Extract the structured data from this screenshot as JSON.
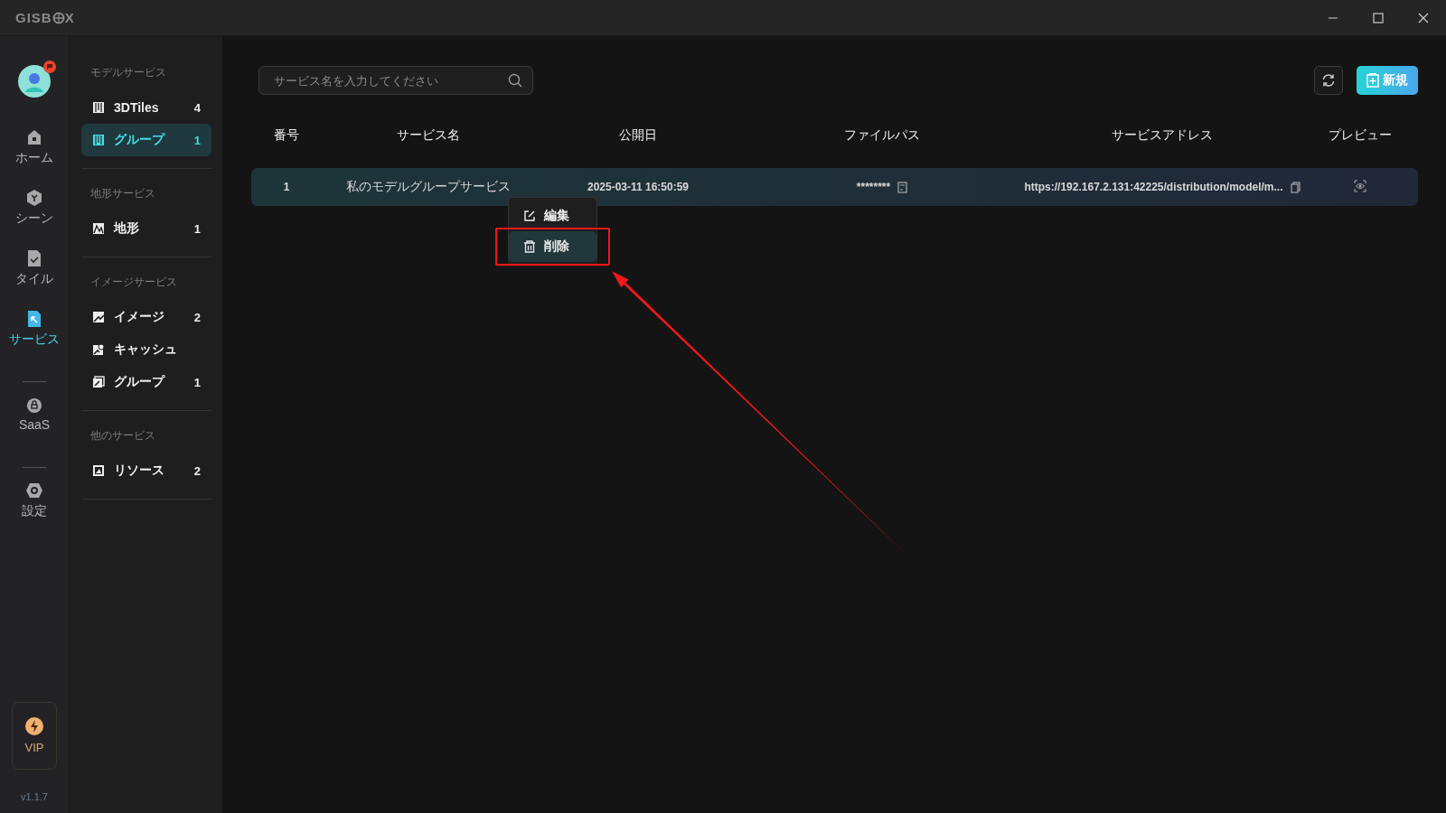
{
  "window": {
    "logo": {
      "before": "GISB",
      "after": "X"
    }
  },
  "rail": {
    "avatar": {
      "badge": true
    },
    "items": [
      {
        "kind": "home",
        "label": "ホーム",
        "selected": false
      },
      {
        "kind": "scene",
        "label": "シーン",
        "selected": false
      },
      {
        "kind": "tile",
        "label": "タイル",
        "selected": false
      },
      {
        "kind": "service",
        "label": "サービス",
        "selected": true
      },
      {
        "kind": "divider"
      },
      {
        "kind": "saas",
        "label": "SaaS",
        "selected": false
      },
      {
        "kind": "divider"
      },
      {
        "kind": "settings",
        "label": "設定",
        "selected": false
      }
    ],
    "vip": {
      "label": "VIP"
    },
    "version": "v1.1.7"
  },
  "sidebar": {
    "sections": [
      {
        "title": "モデルサービス",
        "items": [
          {
            "kind": "model",
            "label": "3DTiles",
            "count": "4",
            "selected": false
          },
          {
            "kind": "model",
            "label": "グループ",
            "count": "1",
            "selected": true
          }
        ]
      },
      {
        "title": "地形サービス",
        "items": [
          {
            "kind": "terrain",
            "label": "地形",
            "count": "1",
            "selected": false
          }
        ]
      },
      {
        "title": "イメージサービス",
        "items": [
          {
            "kind": "image",
            "label": "イメージ",
            "count": "2",
            "selected": false
          },
          {
            "kind": "cache",
            "label": "キャッシュ",
            "selected": false
          },
          {
            "kind": "stack",
            "label": "グループ",
            "count": "1",
            "selected": false
          }
        ]
      },
      {
        "title": "他のサービス",
        "items": [
          {
            "kind": "resource",
            "label": "リソース",
            "count": "2",
            "selected": false
          }
        ]
      }
    ]
  },
  "toolbar": {
    "search": {
      "placeholder": "サービス名を入力してください"
    },
    "new_button": "新規"
  },
  "table": {
    "columns": [
      "番号",
      "サービス名",
      "公開日",
      "ファイルパス",
      "サービスアドレス",
      "プレビュー"
    ],
    "rows": [
      {
        "number": "1",
        "name": "私のモデルグループサービス",
        "date": "2025-03-11 16:50:59",
        "path": "********",
        "address": "https://192.167.2.131:42225/distribution/model/m...",
        "selected": true
      }
    ]
  },
  "context_menu": {
    "items": [
      {
        "kind": "edit",
        "label": "編集",
        "selected": false
      },
      {
        "kind": "delete",
        "label": "削除",
        "selected": true
      }
    ]
  }
}
